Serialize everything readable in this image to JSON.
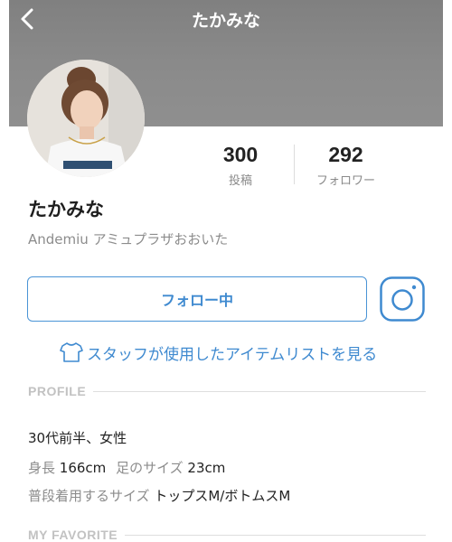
{
  "header": {
    "title": "たかみな"
  },
  "stats": {
    "posts": {
      "value": "300",
      "label": "投稿"
    },
    "followers": {
      "value": "292",
      "label": "フォロワー"
    }
  },
  "profile": {
    "name": "たかみな",
    "shop": "Andemiu アミュプラザおおいた"
  },
  "actions": {
    "follow_label": "フォロー中",
    "staff_items_link": "スタッフが使用したアイテムリストを見る"
  },
  "sections": {
    "profile_title": "PROFILE",
    "favorite_title": "MY FAVORITE"
  },
  "profile_details": {
    "age_gender": "30代前半、女性",
    "height_label": "身長",
    "height_value": "166cm",
    "foot_label": "足のサイズ",
    "foot_value": "23cm",
    "usual_size_label": "普段着用するサイズ",
    "usual_size_value": "トップスM/ボトムスM"
  },
  "icons": {
    "back": "chevron-left-icon",
    "instagram": "instagram-icon",
    "shirt": "shirt-icon"
  },
  "colors": {
    "accent": "#3f8ad0",
    "muted_text": "#8c8c8c",
    "section_title": "#c2c2c2",
    "cover": "#888888"
  }
}
